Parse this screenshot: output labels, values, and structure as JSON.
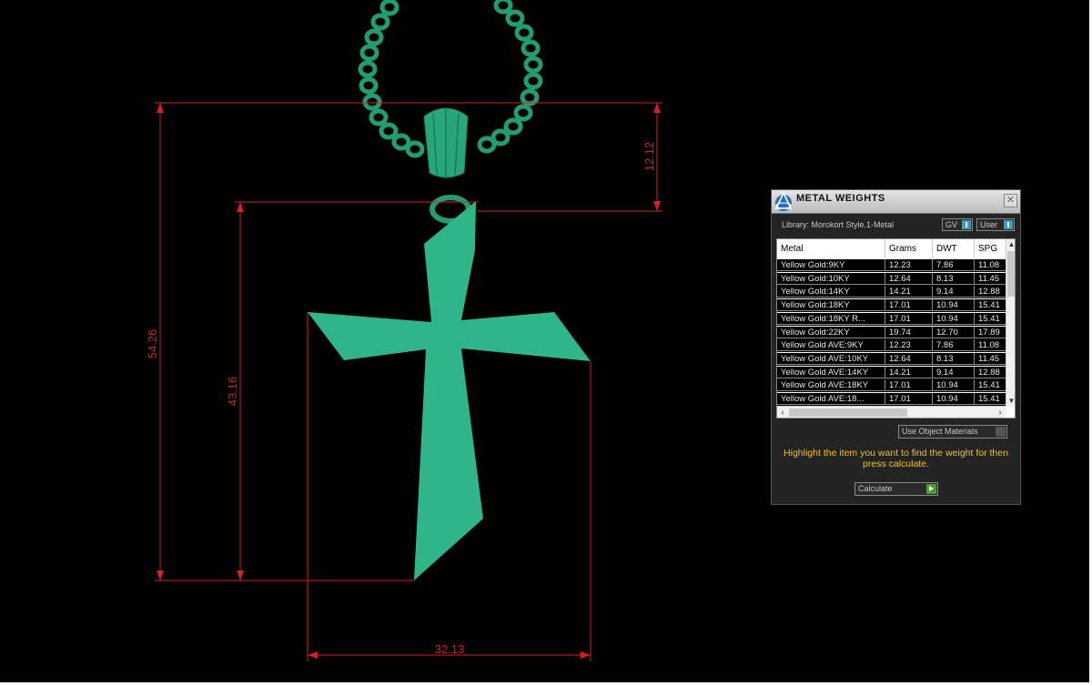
{
  "dimensions": {
    "total_height": "54.26",
    "cross_height": "43.16",
    "bail_height": "12.12",
    "width": "32.13"
  },
  "colors": {
    "model": "#2fb58a",
    "dimension_lines": "#d4202a",
    "hint_text": "#f0c020"
  },
  "panel": {
    "title": "METAL WEIGHTS",
    "close_icon": "close-icon",
    "library_text": "Library: Morokort Style.1-Metal",
    "gv_toggle": "GV",
    "user_toggle": "User",
    "columns": [
      "Metal",
      "Grams",
      "DWT",
      "SPG"
    ],
    "rows": [
      [
        "Yellow Gold:9KY",
        "12.23",
        "7.86",
        "11.08"
      ],
      [
        "Yellow Gold:10KY",
        "12.64",
        "8.13",
        "11.45"
      ],
      [
        "Yellow Gold:14KY",
        "14.21",
        "9.14",
        "12.88"
      ],
      [
        "Yellow Gold:18KY",
        "17.01",
        "10.94",
        "15.41"
      ],
      [
        "Yellow Gold:18KY R...",
        "17.01",
        "10.94",
        "15.41"
      ],
      [
        "Yellow Gold:22KY",
        "19.74",
        "12.70",
        "17.89"
      ],
      [
        "Yellow Gold AVE:9KY",
        "12.23",
        "7.86",
        "11.08"
      ],
      [
        "Yellow Gold AVE:10KY",
        "12.64",
        "8.13",
        "11.45"
      ],
      [
        "Yellow Gold AVE:14KY",
        "14.21",
        "9.14",
        "12.88"
      ],
      [
        "Yellow Gold AVE:18KY",
        "17.01",
        "10.94",
        "15.41"
      ],
      [
        "Yellow Gold AVE:18...",
        "17.01",
        "10.94",
        "15.41"
      ]
    ],
    "use_object_materials": "Use Object Materials",
    "hint": "Highlight the item you want to find the weight for then press calculate.",
    "calculate": "Calculate"
  }
}
